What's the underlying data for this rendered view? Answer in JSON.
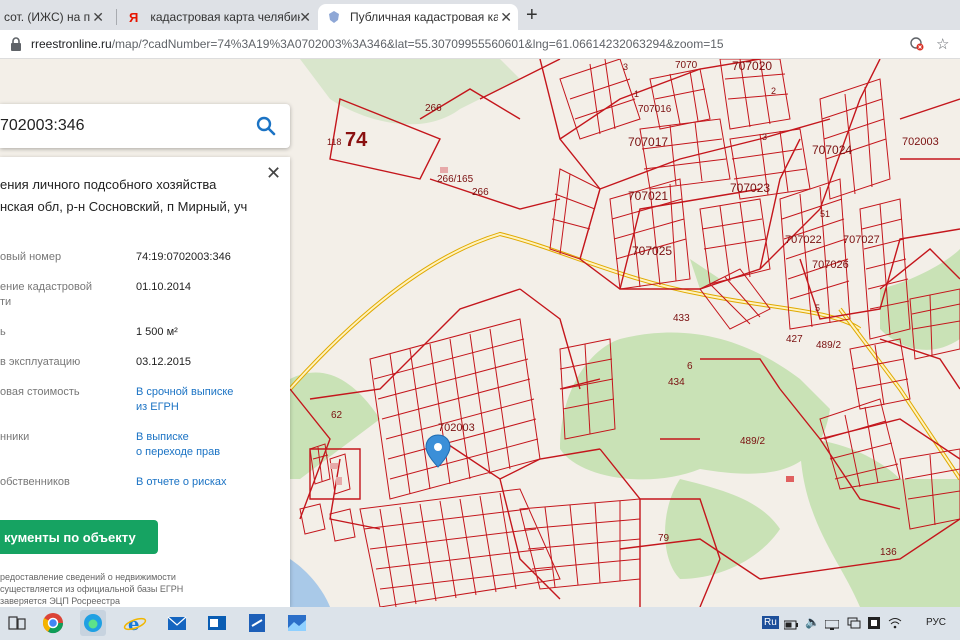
{
  "browser": {
    "tabs": [
      {
        "label": "сот. (ИЖС) на прода",
        "active": false
      },
      {
        "label": "кадастровая карта челябинской",
        "favicon": "Я",
        "active": false
      },
      {
        "label": "Публичная кадастровая карта",
        "active": true
      }
    ],
    "new_tab": "+",
    "url_host": "rreestronline.ru",
    "url_path": "/map/?cadNumber=74%3A19%3A0702003%3A346&lat=55.30709955560601&lng=61.06614232063294&zoom=15"
  },
  "search": {
    "value": "702003:346"
  },
  "panel": {
    "title": "ения личного подсобного хозяйства",
    "address": "нская обл, р-н Сосновский, п Мирный, уч",
    "rows": [
      {
        "key": "овый номер",
        "value": "74:19:0702003:346",
        "link": false
      },
      {
        "key": "ение кадастровой",
        "key2": "ти",
        "value": "01.10.2014",
        "link": false
      },
      {
        "key": "ь",
        "value": "1 500 м²",
        "link": false
      },
      {
        "key": "в эксплуатацию",
        "value": "03.12.2015",
        "link": false
      },
      {
        "key": "овая стоимость",
        "value": "В срочной выписке",
        "value2": "из ЕГРН",
        "link": true
      },
      {
        "key": "нники",
        "value": "В выписке",
        "value2": "о переходе прав",
        "link": true
      },
      {
        "key": "обственников",
        "value": "В отчете о рисках",
        "link": true
      }
    ],
    "doc_button": "кументы по объекту",
    "footnote": [
      "редоставление сведений о недвижимости",
      "существляется из официальной базы ЕГРН",
      "заверяется ЭЦП Росреестра"
    ]
  },
  "map_labels": [
    "74",
    "118",
    "266",
    "266/165",
    "266",
    "7070",
    "707016",
    "707017",
    "707020",
    "707021",
    "707023",
    "707024",
    "707025",
    "707026",
    "707027",
    "707022",
    "702003",
    "433",
    "6",
    "434",
    "427",
    "489/2",
    "62",
    "702003",
    "489/2",
    "79",
    "136",
    "3",
    "1",
    "2",
    "3",
    "5",
    "51"
  ],
  "taskbar": {
    "tray": {
      "lang": "РУС",
      "ru_badge": "Ru"
    }
  }
}
